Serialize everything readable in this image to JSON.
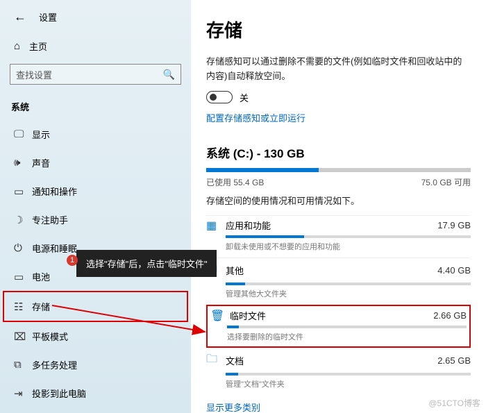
{
  "header": {
    "title": "设置"
  },
  "home": {
    "label": "主页"
  },
  "search": {
    "placeholder": "查找设置"
  },
  "section": {
    "title": "系统"
  },
  "nav": {
    "display": "显示",
    "sound": "声音",
    "notifications": "通知和操作",
    "focus": "专注助手",
    "power": "电源和睡眠",
    "battery": "电池",
    "storage": "存储",
    "tablet": "平板模式",
    "multitask": "多任务处理",
    "project": "投影到此电脑"
  },
  "main": {
    "title": "存储",
    "desc": "存储感知可以通过删除不需要的文件(例如临时文件和回收站中的内容)自动释放空间。",
    "toggle_off": "关",
    "config_link": "配置存储感知或立即运行",
    "drive_title": "系统 (C:) - 130 GB",
    "used_label": "已使用 55.4 GB",
    "free_label": "75.0 GB 可用",
    "usage_desc": "存储空间的使用情况和可用情况如下。",
    "show_more": "显示更多类别"
  },
  "categories": [
    {
      "name": "应用和功能",
      "size": "17.9 GB",
      "hint": "卸载未使用或不想要的应用和功能",
      "pct": 32
    },
    {
      "name": "其他",
      "size": "4.40 GB",
      "hint": "管理其他大文件夹",
      "pct": 8
    },
    {
      "name": "临时文件",
      "size": "2.66 GB",
      "hint": "选择要删除的临时文件",
      "pct": 5
    },
    {
      "name": "文档",
      "size": "2.65 GB",
      "hint": "管理\"文档\"文件夹",
      "pct": 5
    }
  ],
  "tooltip": {
    "badge": "1",
    "text": "选择\"存储\"后，点击\"临时文件\""
  },
  "watermark": "@51CTO博客",
  "chart_data": {
    "type": "bar",
    "title": "系统 (C:) - 130 GB",
    "total_gb": 130,
    "used_gb": 55.4,
    "free_gb": 75.0,
    "categories": [
      "应用和功能",
      "其他",
      "临时文件",
      "文档"
    ],
    "values_gb": [
      17.9,
      4.4,
      2.66,
      2.65
    ]
  }
}
